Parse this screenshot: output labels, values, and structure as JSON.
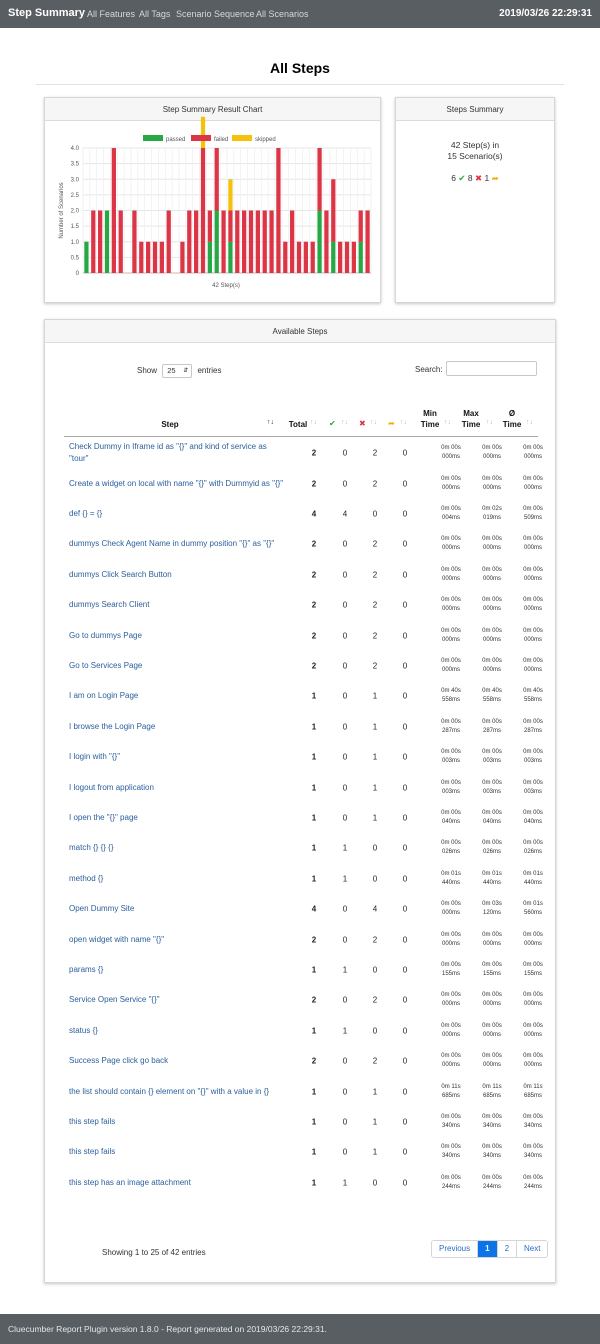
{
  "nav": {
    "brand": "Step Summary",
    "links": [
      "All Features",
      "All Tags",
      "Scenario Sequence",
      "All Scenarios"
    ],
    "timestamp": "2019/03/26 22:29:31"
  },
  "page_title": "All Steps",
  "chart_card": {
    "title": "Step Summary Result Chart"
  },
  "chart_data": {
    "type": "bar",
    "stacked": true,
    "legend": [
      "passed",
      "failed",
      "skipped"
    ],
    "legend_position": "top",
    "colors": {
      "passed": "#28a745",
      "failed": "#dc3545",
      "skipped": "#f4c20d"
    },
    "xlabel": "42 Step(s)",
    "ylabel": "Number of Scenarios",
    "ylim": [
      0,
      4
    ],
    "yticks": [
      "0",
      "0.5",
      "1.0",
      "1.5",
      "2.0",
      "2.5",
      "3.0",
      "3.5",
      "4.0"
    ],
    "grid": true,
    "series": [
      {
        "name": "passed",
        "values": [
          1,
          0,
          0,
          2,
          0,
          0,
          0,
          0,
          0,
          0,
          0,
          0,
          0,
          0,
          0,
          0,
          0,
          0,
          1,
          2,
          0,
          1,
          0,
          0,
          0,
          0,
          0,
          0,
          0,
          0,
          0,
          0,
          0,
          0,
          2,
          0,
          1,
          0,
          0,
          0,
          1,
          0
        ]
      },
      {
        "name": "failed",
        "values": [
          0,
          2,
          2,
          0,
          4,
          2,
          0,
          2,
          1,
          1,
          1,
          1,
          2,
          0,
          1,
          2,
          2,
          4,
          1,
          2,
          2,
          1,
          2,
          2,
          2,
          2,
          2,
          2,
          4,
          1,
          2,
          1,
          1,
          1,
          2,
          2,
          2,
          1,
          1,
          1,
          1,
          2
        ]
      },
      {
        "name": "skipped",
        "values": [
          0,
          0,
          0,
          0,
          0,
          0,
          0,
          0,
          0,
          0,
          0,
          0,
          0,
          0,
          0,
          0,
          0,
          1,
          0,
          0,
          0,
          1,
          0,
          0,
          0,
          0,
          0,
          0,
          0,
          0,
          0,
          0,
          0,
          0,
          0,
          0,
          0,
          0,
          0,
          0,
          0,
          0
        ]
      }
    ]
  },
  "summary_card": {
    "title": "Steps Summary",
    "line1": "42 Step(s) in",
    "line2": "15 Scenario(s)",
    "passed": "6",
    "failed": "8",
    "skipped": "1",
    "colors": {
      "passed": "#28a745",
      "failed": "#dc3545",
      "skipped": "#f0ad00"
    }
  },
  "steps_card": {
    "title": "Available Steps",
    "show_label": "Show",
    "page_size": "25",
    "entries_label": "entries",
    "search_label": "Search:",
    "search_value": "",
    "headers": {
      "step": "Step",
      "total": "Total",
      "min1": "Min",
      "min2": "Time",
      "max1": "Max",
      "max2": "Time",
      "avg1": "Ø",
      "avg2": "Time"
    },
    "rows": [
      {
        "name": "Check Dummy in Iframe id as \"{}\" and kind of service as \"tour\"",
        "total": "2",
        "passed": "0",
        "failed": "2",
        "skipped": "0",
        "min1": "0m 00s",
        "min2": "000ms",
        "max1": "0m 00s",
        "max2": "000ms",
        "avg1": "0m 00s",
        "avg2": "000ms"
      },
      {
        "name": "Create a widget on local with name \"{}\" with Dummyid as \"{}\"",
        "total": "2",
        "passed": "0",
        "failed": "2",
        "skipped": "0",
        "min1": "0m 00s",
        "min2": "000ms",
        "max1": "0m 00s",
        "max2": "000ms",
        "avg1": "0m 00s",
        "avg2": "000ms"
      },
      {
        "name": "def {} = {}",
        "total": "4",
        "passed": "4",
        "failed": "0",
        "skipped": "0",
        "min1": "0m 00s",
        "min2": "004ms",
        "max1": "0m 02s",
        "max2": "019ms",
        "avg1": "0m 00s",
        "avg2": "509ms"
      },
      {
        "name": "dummys Check Agent Name in dummy position \"{}\" as \"{}\"",
        "total": "2",
        "passed": "0",
        "failed": "2",
        "skipped": "0",
        "min1": "0m 00s",
        "min2": "000ms",
        "max1": "0m 00s",
        "max2": "000ms",
        "avg1": "0m 00s",
        "avg2": "000ms"
      },
      {
        "name": "dummys Click Search Button",
        "total": "2",
        "passed": "0",
        "failed": "2",
        "skipped": "0",
        "min1": "0m 00s",
        "min2": "000ms",
        "max1": "0m 00s",
        "max2": "000ms",
        "avg1": "0m 00s",
        "avg2": "000ms"
      },
      {
        "name": "dummys Search Client",
        "total": "2",
        "passed": "0",
        "failed": "2",
        "skipped": "0",
        "min1": "0m 00s",
        "min2": "000ms",
        "max1": "0m 00s",
        "max2": "000ms",
        "avg1": "0m 00s",
        "avg2": "000ms"
      },
      {
        "name": "Go to dummys Page",
        "total": "2",
        "passed": "0",
        "failed": "2",
        "skipped": "0",
        "min1": "0m 00s",
        "min2": "000ms",
        "max1": "0m 00s",
        "max2": "000ms",
        "avg1": "0m 00s",
        "avg2": "000ms"
      },
      {
        "name": "Go to Services Page",
        "total": "2",
        "passed": "0",
        "failed": "2",
        "skipped": "0",
        "min1": "0m 00s",
        "min2": "000ms",
        "max1": "0m 00s",
        "max2": "000ms",
        "avg1": "0m 00s",
        "avg2": "000ms"
      },
      {
        "name": "I am on Login Page",
        "total": "1",
        "passed": "0",
        "failed": "1",
        "skipped": "0",
        "min1": "0m 40s",
        "min2": "558ms",
        "max1": "0m 40s",
        "max2": "558ms",
        "avg1": "0m 40s",
        "avg2": "558ms"
      },
      {
        "name": "I browse the Login Page",
        "total": "1",
        "passed": "0",
        "failed": "1",
        "skipped": "0",
        "min1": "0m 00s",
        "min2": "287ms",
        "max1": "0m 00s",
        "max2": "287ms",
        "avg1": "0m 00s",
        "avg2": "287ms"
      },
      {
        "name": "I login with \"{}\"",
        "total": "1",
        "passed": "0",
        "failed": "1",
        "skipped": "0",
        "min1": "0m 00s",
        "min2": "003ms",
        "max1": "0m 00s",
        "max2": "003ms",
        "avg1": "0m 00s",
        "avg2": "003ms"
      },
      {
        "name": "I logout from application",
        "total": "1",
        "passed": "0",
        "failed": "1",
        "skipped": "0",
        "min1": "0m 00s",
        "min2": "003ms",
        "max1": "0m 00s",
        "max2": "003ms",
        "avg1": "0m 00s",
        "avg2": "003ms"
      },
      {
        "name": "I open the \"{}\" page",
        "total": "1",
        "passed": "0",
        "failed": "1",
        "skipped": "0",
        "min1": "0m 00s",
        "min2": "040ms",
        "max1": "0m 00s",
        "max2": "040ms",
        "avg1": "0m 00s",
        "avg2": "040ms"
      },
      {
        "name": "match {} {} {}",
        "total": "1",
        "passed": "1",
        "failed": "0",
        "skipped": "0",
        "min1": "0m 00s",
        "min2": "026ms",
        "max1": "0m 00s",
        "max2": "026ms",
        "avg1": "0m 00s",
        "avg2": "026ms"
      },
      {
        "name": "method {}",
        "total": "1",
        "passed": "1",
        "failed": "0",
        "skipped": "0",
        "min1": "0m 01s",
        "min2": "440ms",
        "max1": "0m 01s",
        "max2": "440ms",
        "avg1": "0m 01s",
        "avg2": "440ms"
      },
      {
        "name": "Open Dummy Site",
        "total": "4",
        "passed": "0",
        "failed": "4",
        "skipped": "0",
        "min1": "0m 00s",
        "min2": "000ms",
        "max1": "0m 03s",
        "max2": "120ms",
        "avg1": "0m 01s",
        "avg2": "560ms"
      },
      {
        "name": "open widget with name \"{}\"",
        "total": "2",
        "passed": "0",
        "failed": "2",
        "skipped": "0",
        "min1": "0m 00s",
        "min2": "000ms",
        "max1": "0m 00s",
        "max2": "000ms",
        "avg1": "0m 00s",
        "avg2": "000ms"
      },
      {
        "name": "params {}",
        "total": "1",
        "passed": "1",
        "failed": "0",
        "skipped": "0",
        "min1": "0m 00s",
        "min2": "155ms",
        "max1": "0m 00s",
        "max2": "155ms",
        "avg1": "0m 00s",
        "avg2": "155ms"
      },
      {
        "name": "Service Open Service \"{}\"",
        "total": "2",
        "passed": "0",
        "failed": "2",
        "skipped": "0",
        "min1": "0m 00s",
        "min2": "000ms",
        "max1": "0m 00s",
        "max2": "000ms",
        "avg1": "0m 00s",
        "avg2": "000ms"
      },
      {
        "name": "status {}",
        "total": "1",
        "passed": "1",
        "failed": "0",
        "skipped": "0",
        "min1": "0m 00s",
        "min2": "000ms",
        "max1": "0m 00s",
        "max2": "000ms",
        "avg1": "0m 00s",
        "avg2": "000ms"
      },
      {
        "name": "Success Page click go back",
        "total": "2",
        "passed": "0",
        "failed": "2",
        "skipped": "0",
        "min1": "0m 00s",
        "min2": "000ms",
        "max1": "0m 00s",
        "max2": "000ms",
        "avg1": "0m 00s",
        "avg2": "000ms"
      },
      {
        "name": "the list should contain {} element on \"{}\" with a value in {}",
        "total": "1",
        "passed": "0",
        "failed": "1",
        "skipped": "0",
        "min1": "0m 11s",
        "min2": "685ms",
        "max1": "0m 11s",
        "max2": "685ms",
        "avg1": "0m 11s",
        "avg2": "685ms"
      },
      {
        "name": "this step fails",
        "total": "1",
        "passed": "0",
        "failed": "1",
        "skipped": "0",
        "min1": "0m 00s",
        "min2": "340ms",
        "max1": "0m 00s",
        "max2": "340ms",
        "avg1": "0m 00s",
        "avg2": "340ms"
      },
      {
        "name": "this step fails",
        "total": "1",
        "passed": "0",
        "failed": "1",
        "skipped": "0",
        "min1": "0m 00s",
        "min2": "340ms",
        "max1": "0m 00s",
        "max2": "340ms",
        "avg1": "0m 00s",
        "avg2": "340ms"
      },
      {
        "name": "this step has an image attachment",
        "total": "1",
        "passed": "1",
        "failed": "0",
        "skipped": "0",
        "min1": "0m 00s",
        "min2": "244ms",
        "max1": "0m 00s",
        "max2": "244ms",
        "avg1": "0m 00s",
        "avg2": "244ms"
      }
    ],
    "info": "Showing 1 to 25 of 42 entries",
    "pagination": {
      "previous": "Previous",
      "pages": [
        "1",
        "2"
      ],
      "current": "1",
      "next": "Next"
    }
  },
  "footer": {
    "text": "Cluecumber Report Plugin version 1.8.0 - Report generated on 2019/03/26 22:29:31."
  }
}
